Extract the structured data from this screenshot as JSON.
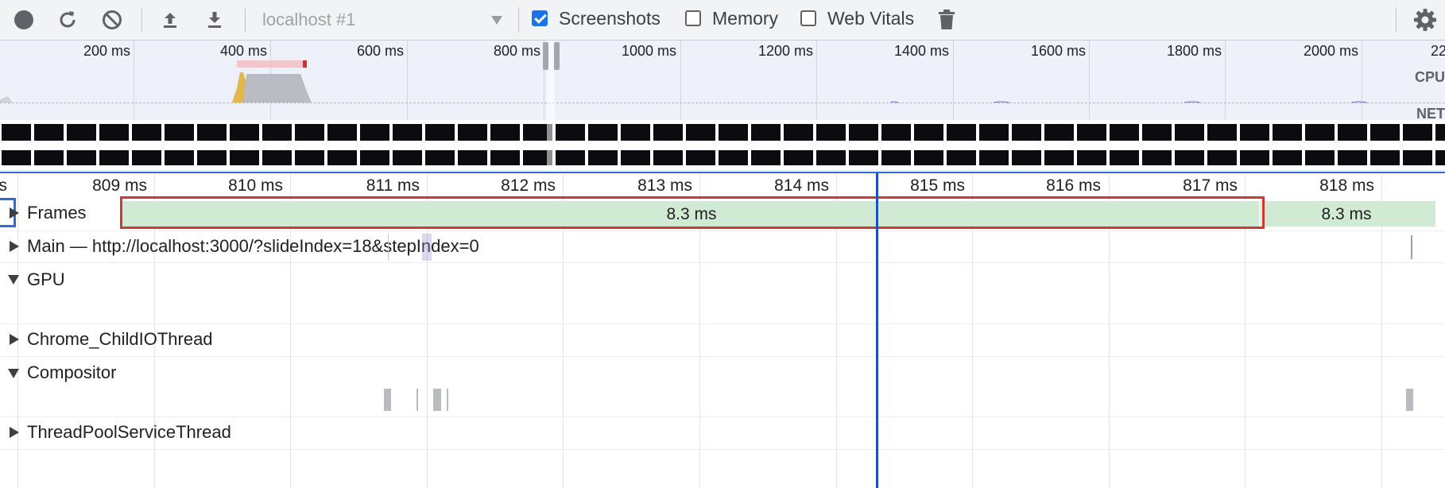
{
  "toolbar": {
    "profile_select": "localhost #1",
    "screenshots_label": "Screenshots",
    "screenshots_checked": true,
    "memory_label": "Memory",
    "memory_checked": false,
    "web_vitals_label": "Web Vitals",
    "web_vitals_checked": false,
    "icons": [
      "record-icon",
      "reload-icon",
      "clear-icon",
      "upload-icon",
      "download-icon",
      "trash-icon",
      "gear-icon"
    ]
  },
  "overview": {
    "ticks": [
      "200 ms",
      "400 ms",
      "600 ms",
      "800 ms",
      "1000 ms",
      "1200 ms",
      "1400 ms",
      "1600 ms",
      "1800 ms",
      "2000 ms",
      "22"
    ],
    "cpu_label": "CPU",
    "net_label": "NET"
  },
  "timeline": {
    "ticks": [
      "ıs",
      "809 ms",
      "810 ms",
      "811 ms",
      "812 ms",
      "813 ms",
      "814 ms",
      "815 ms",
      "816 ms",
      "817 ms",
      "818 ms"
    ],
    "frames": {
      "label": "Frames",
      "durations": [
        "8.3 ms",
        "8.3 ms"
      ]
    },
    "tracks": {
      "main": "Main — http://localhost:3000/?slideIndex=18&stepIndex=0",
      "gpu": "GPU",
      "child_io": "Chrome_ChildIOThread",
      "compositor": "Compositor",
      "thread_pool": "ThreadPoolServiceThread"
    }
  },
  "colors": {
    "accent_blue": "#1a73e8",
    "frames_green": "#d1ead3",
    "selection_red": "#cc3b30",
    "cursor_blue": "#1d4fbf",
    "overview_bg": "#eef1f9"
  }
}
